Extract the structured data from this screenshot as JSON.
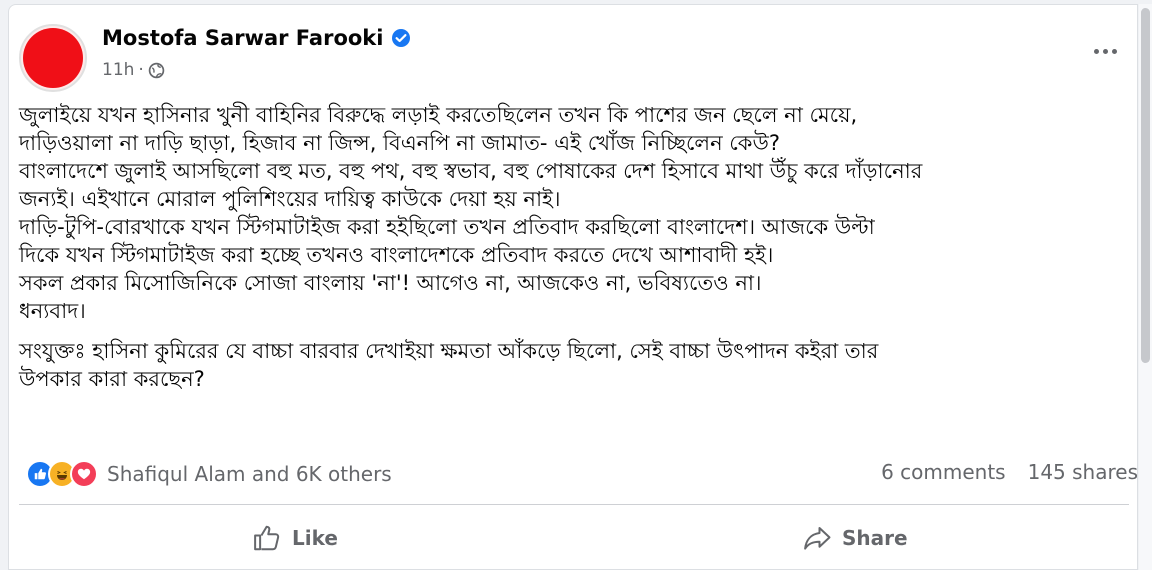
{
  "post": {
    "author": "Mostofa Sarwar Farooki",
    "time": "11h",
    "separator": "·",
    "body_lines": [
      "জুলাইয়ে যখন হাসিনার খুনী বাহিনির বিরুদ্ধে লড়াই করতেছিলেন তখন কি পাশের জন ছেলে না মেয়ে,",
      "দাড়িওয়ালা না দাড়ি ছাড়া, হিজাব না জিন্স, বিএনপি না জামাত- এই খোঁজ নিচ্ছিলেন কেউ?",
      "বাংলাদেশে জুলাই আসছিলো বহু মত, বহু পথ, বহু স্বভাব, বহু পোষাকের দেশ হিসাবে মাথা উঁচু করে দাঁড়ানোর",
      "জন্যই। এইখানে মোরাল পুলিশিংয়ের দায়িত্ব কাউকে দেয়া হয় নাই।",
      "দাড়ি-টুপি-বোরখাকে যখন স্টিগমাটাইজ করা হইছিলো তখন প্রতিবাদ করছিলো বাংলাদেশ। আজকে উল্টা",
      "দিকে যখন স্টিগমাটাইজ করা হচ্ছে তখনও বাংলাদেশকে প্রতিবাদ করতে দেখে আশাবাদী হই।",
      "সকল প্রকার মিসোজিনিকে সোজা বাংলায় 'না'! আগেও না, আজকেও না, ভবিষ্যতেও না।",
      "ধন্যবাদ।"
    ],
    "ps_lines": [
      "সংযুক্তঃ হাসিনা কুমিরের যে বাচ্চা বারবার দেখাইয়া ক্ষমতা আঁকড়ে ছিলো, সেই বাচ্চা উৎপাদন কইরা তার",
      "উপকার কারা করছেন?"
    ],
    "reactions_text": "Shafiqul Alam and 6K others",
    "comments": "6 comments",
    "shares": "145 shares"
  },
  "actions": {
    "like": "Like",
    "share": "Share"
  },
  "icons": {
    "verified": "verified-badge-icon",
    "globe": "globe-icon",
    "more": "more-options-icon",
    "reactions": [
      "like-reaction-icon",
      "haha-reaction-icon",
      "love-reaction-icon"
    ],
    "like": "thumbs-up-icon",
    "share": "share-arrow-icon"
  },
  "colors": {
    "avatar": "#f00f17",
    "verified": "#1877f2",
    "text": "#050505",
    "secondary": "#65676b"
  }
}
